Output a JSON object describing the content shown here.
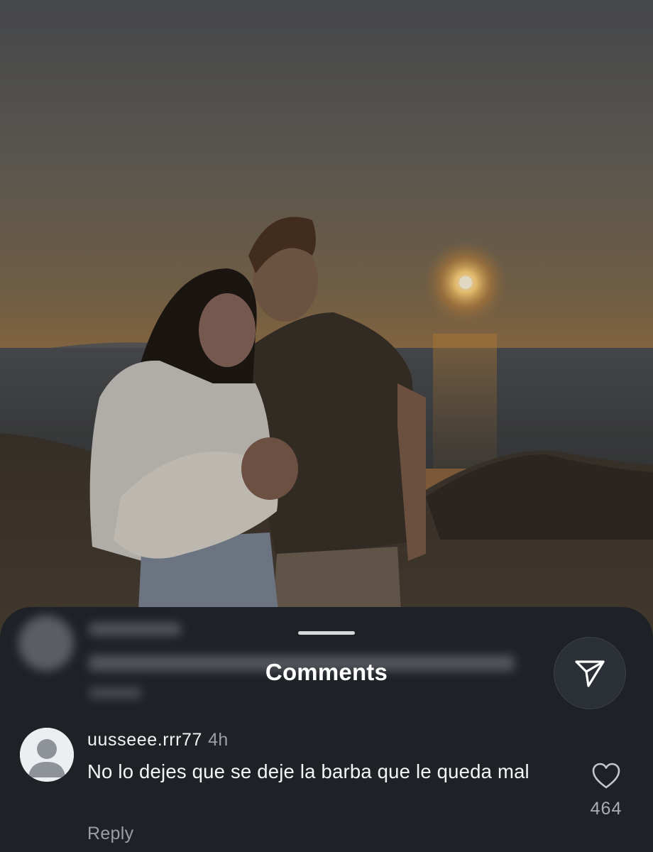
{
  "sheet": {
    "title": "Comments",
    "share_icon": "paper-plane-icon"
  },
  "comments": [
    {
      "username": "uusseee.rrr77",
      "time": "4h",
      "text": "No lo dejes que se deje la barba que le queda mal",
      "reply_label": "Reply",
      "like_icon": "heart-outline-icon",
      "like_count": "464"
    }
  ],
  "colors": {
    "sheet_bg": "#1e2126",
    "text_primary": "#f4f5f7",
    "text_secondary": "#9a9ea6"
  }
}
